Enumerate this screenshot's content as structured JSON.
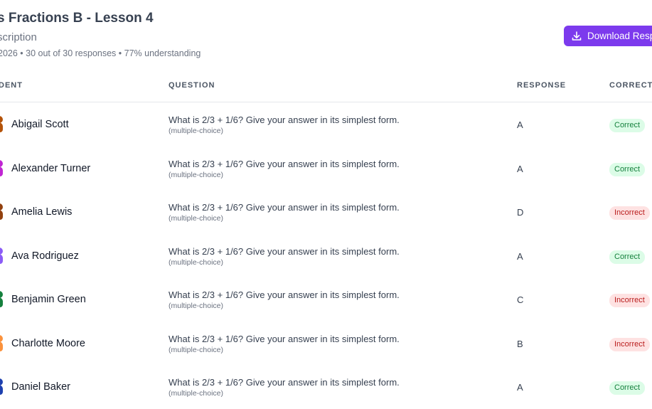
{
  "header": {
    "title": "s Fractions B - Lesson 4",
    "subtitle": "scription",
    "meta": "2026 • 30 out of 30 responses • 77% understanding",
    "download_label": "Download Resp",
    "accent_color": "#7c3aed"
  },
  "table": {
    "columns": {
      "student": "DENT",
      "question": "QUESTION",
      "response": "RESPONSE",
      "correct": "CORRECT"
    },
    "rows": [
      {
        "name": "Abigail Scott",
        "question": "What is 2/3 + 1/6? Give your answer in its simplest form.",
        "type": "(multiple-choice)",
        "response": "A",
        "status": "Correct",
        "avatar_color": "#b45309"
      },
      {
        "name": "Alexander Turner",
        "question": "What is 2/3 + 1/6? Give your answer in its simplest form.",
        "type": "(multiple-choice)",
        "response": "A",
        "status": "Correct",
        "avatar_color": "#c026d3"
      },
      {
        "name": "Amelia Lewis",
        "question": "What is 2/3 + 1/6? Give your answer in its simplest form.",
        "type": "(multiple-choice)",
        "response": "D",
        "status": "Incorrect",
        "avatar_color": "#92400e"
      },
      {
        "name": "Ava Rodriguez",
        "question": "What is 2/3 + 1/6? Give your answer in its simplest form.",
        "type": "(multiple-choice)",
        "response": "A",
        "status": "Correct",
        "avatar_color": "#8b5cf6"
      },
      {
        "name": "Benjamin Green",
        "question": "What is 2/3 + 1/6? Give your answer in its simplest form.",
        "type": "(multiple-choice)",
        "response": "C",
        "status": "Incorrect",
        "avatar_color": "#15803d"
      },
      {
        "name": "Charlotte Moore",
        "question": "What is 2/3 + 1/6? Give your answer in its simplest form.",
        "type": "(multiple-choice)",
        "response": "B",
        "status": "Incorrect",
        "avatar_color": "#fb923c"
      },
      {
        "name": "Daniel Baker",
        "question": "What is 2/3 + 1/6? Give your answer in its simplest form.",
        "type": "(multiple-choice)",
        "response": "A",
        "status": "Correct",
        "avatar_color": "#1e40af"
      }
    ]
  }
}
